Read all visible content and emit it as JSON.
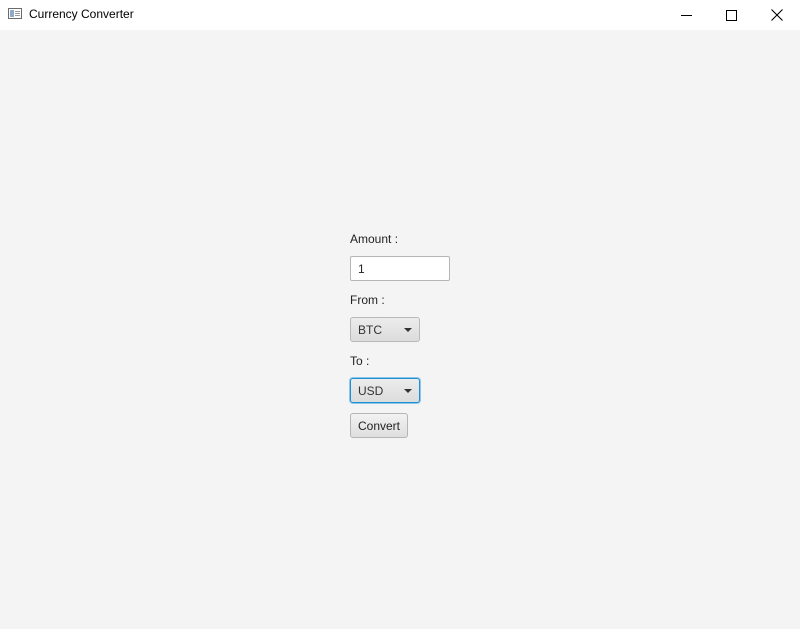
{
  "window": {
    "title": "Currency Converter",
    "icons": {
      "app": "app-window-icon",
      "minimize": "minimize-icon",
      "maximize": "maximize-icon",
      "close": "close-icon"
    }
  },
  "form": {
    "amount_label": "Amount :",
    "amount_value": "1",
    "from_label": "From :",
    "from_selected": "BTC",
    "to_label": "To :",
    "to_selected": "USD",
    "convert_label": "Convert"
  },
  "colors": {
    "background": "#f4f4f4",
    "focus_border": "#1e8fd0"
  }
}
